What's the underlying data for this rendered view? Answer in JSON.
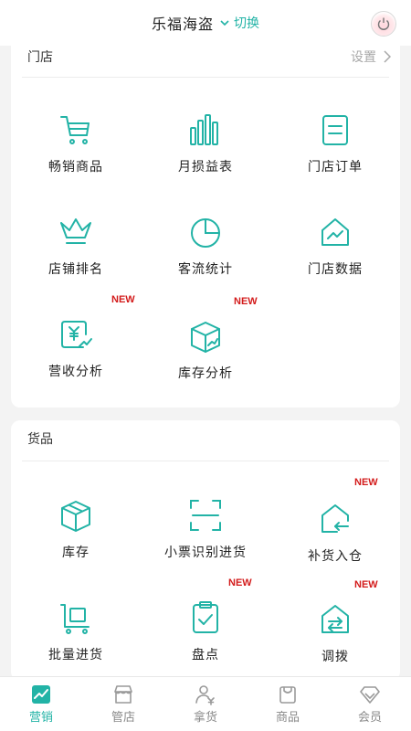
{
  "header": {
    "store_name": "乐福海盗",
    "switch_label": "切换",
    "power_icon": "power-icon"
  },
  "store_section": {
    "title": "门店",
    "settings_label": "设置",
    "items": [
      {
        "label": "畅销商品",
        "icon": "cart-icon",
        "badge": ""
      },
      {
        "label": "月损益表",
        "icon": "bar-chart-icon",
        "badge": ""
      },
      {
        "label": "门店订单",
        "icon": "order-list-icon",
        "badge": ""
      },
      {
        "label": "店铺排名",
        "icon": "crown-icon",
        "badge": ""
      },
      {
        "label": "客流统计",
        "icon": "pie-chart-icon",
        "badge": ""
      },
      {
        "label": "门店数据",
        "icon": "house-trend-icon",
        "badge": ""
      },
      {
        "label": "营收分析",
        "icon": "yuan-trend-icon",
        "badge": "NEW"
      },
      {
        "label": "库存分析",
        "icon": "box-trend-icon",
        "badge": "NEW"
      }
    ]
  },
  "goods_section": {
    "title": "货品",
    "items": [
      {
        "label": "库存",
        "icon": "box-icon",
        "badge": ""
      },
      {
        "label": "小票识别进货",
        "icon": "scan-icon",
        "badge": ""
      },
      {
        "label": "补货入仓",
        "icon": "house-return-icon",
        "badge": "NEW"
      },
      {
        "label": "批量进货",
        "icon": "cart-box-icon",
        "badge": ""
      },
      {
        "label": "盘点",
        "icon": "clipboard-check-icon",
        "badge": "NEW"
      },
      {
        "label": "调拨",
        "icon": "house-transfer-icon",
        "badge": "NEW"
      }
    ]
  },
  "tabbar": {
    "tabs": [
      {
        "label": "营销",
        "icon": "marketing-icon",
        "active": true
      },
      {
        "label": "管店",
        "icon": "store-icon",
        "active": false
      },
      {
        "label": "拿货",
        "icon": "person-yuan-icon",
        "active": false
      },
      {
        "label": "商品",
        "icon": "bag-icon",
        "active": false
      },
      {
        "label": "会员",
        "icon": "diamond-icon",
        "active": false
      }
    ]
  },
  "colors": {
    "accent": "#22b3a6",
    "badge": "#d31b1b",
    "background": "#f3f3f3"
  }
}
